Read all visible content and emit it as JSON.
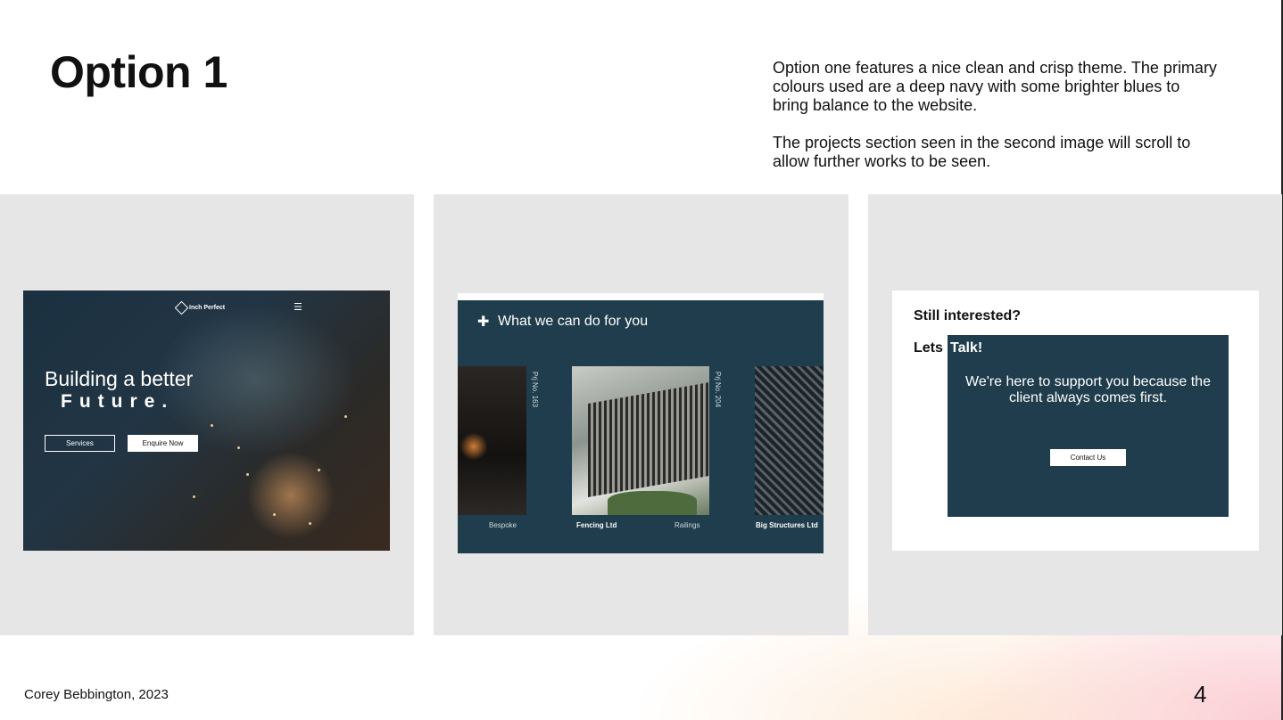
{
  "slide": {
    "title": "Option 1",
    "description": [
      "Option one features a nice clean and crisp theme. The primary colours used are a deep navy with some brighter blues to bring balance to the website.",
      "The projects section seen in the second image will scroll to allow further works to be seen."
    ],
    "footer": "Corey Bebbington, 2023",
    "page_number": "4"
  },
  "shot_hero": {
    "logo_text": "Inch Perfect",
    "menu_icon": "hamburger-icon",
    "headline_1": "Building a better",
    "headline_2": "Future.",
    "button_services": "Services",
    "button_enquire": "Enquire Now"
  },
  "shot_projects": {
    "plus_icon": "plus-icon",
    "title": "What we can do for you",
    "project_labels": [
      "Prj No. 163",
      "Prj No. 204"
    ],
    "captions": [
      "Bespoke",
      "Fencing Ltd",
      "Railings",
      "Big Structures Ltd"
    ]
  },
  "shot_contact": {
    "question": "Still interested?",
    "lets": "Lets",
    "talk": "Talk!",
    "message": "We're here to support you because the client always comes first.",
    "button": "Contact Us"
  },
  "colors": {
    "navy": "#1f3d4c",
    "panel_grey": "#e6e6e6"
  }
}
